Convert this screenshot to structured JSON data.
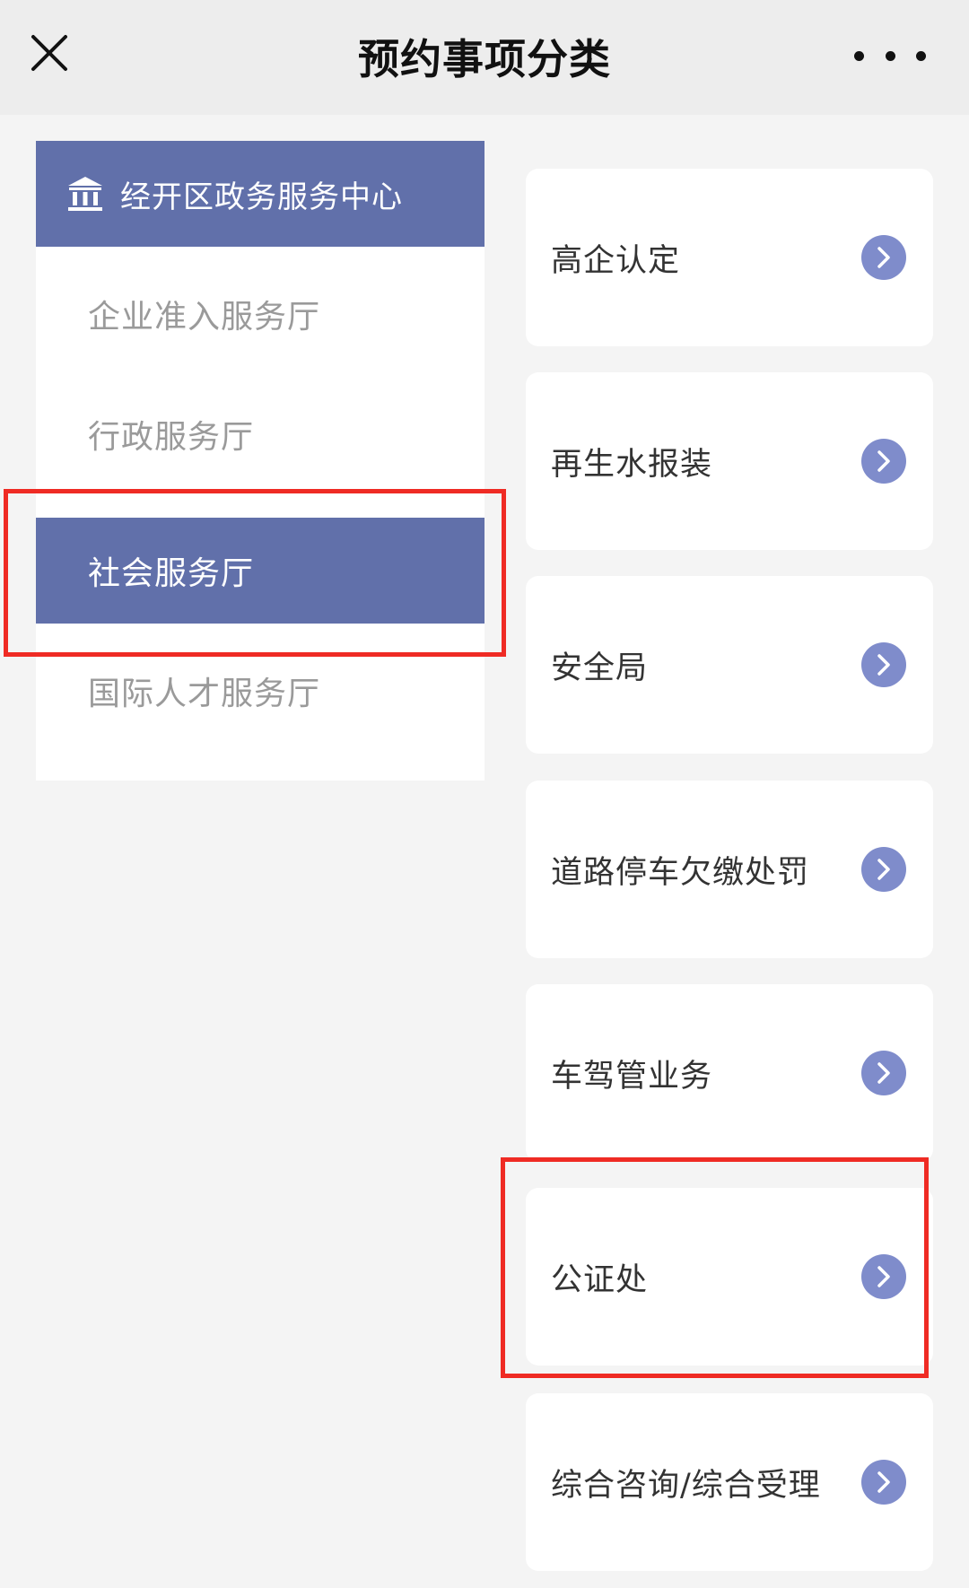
{
  "header": {
    "title": "预约事项分类",
    "close_icon": "close-icon",
    "more_icon": "more-dots-icon"
  },
  "left": {
    "center_name": "经开区政务服务中心",
    "center_icon": "bank-icon",
    "halls": [
      {
        "label": "企业准入服务厅",
        "active": false
      },
      {
        "label": "行政服务厅",
        "active": false
      },
      {
        "label": "社会服务厅",
        "active": true
      },
      {
        "label": "国际人才服务厅",
        "active": false
      }
    ]
  },
  "right": {
    "items": [
      {
        "label": "高企认定"
      },
      {
        "label": "再生水报装"
      },
      {
        "label": "安全局"
      },
      {
        "label": "道路停车欠缴处罚"
      },
      {
        "label": "车驾管业务"
      },
      {
        "label": "公证处"
      },
      {
        "label": "综合咨询/综合受理"
      }
    ],
    "arrow_icon": "chevron-right-circle-icon"
  },
  "colors": {
    "accent": "#6170aa",
    "arrow": "#7f8ccb",
    "highlight": "#ef2b24"
  }
}
